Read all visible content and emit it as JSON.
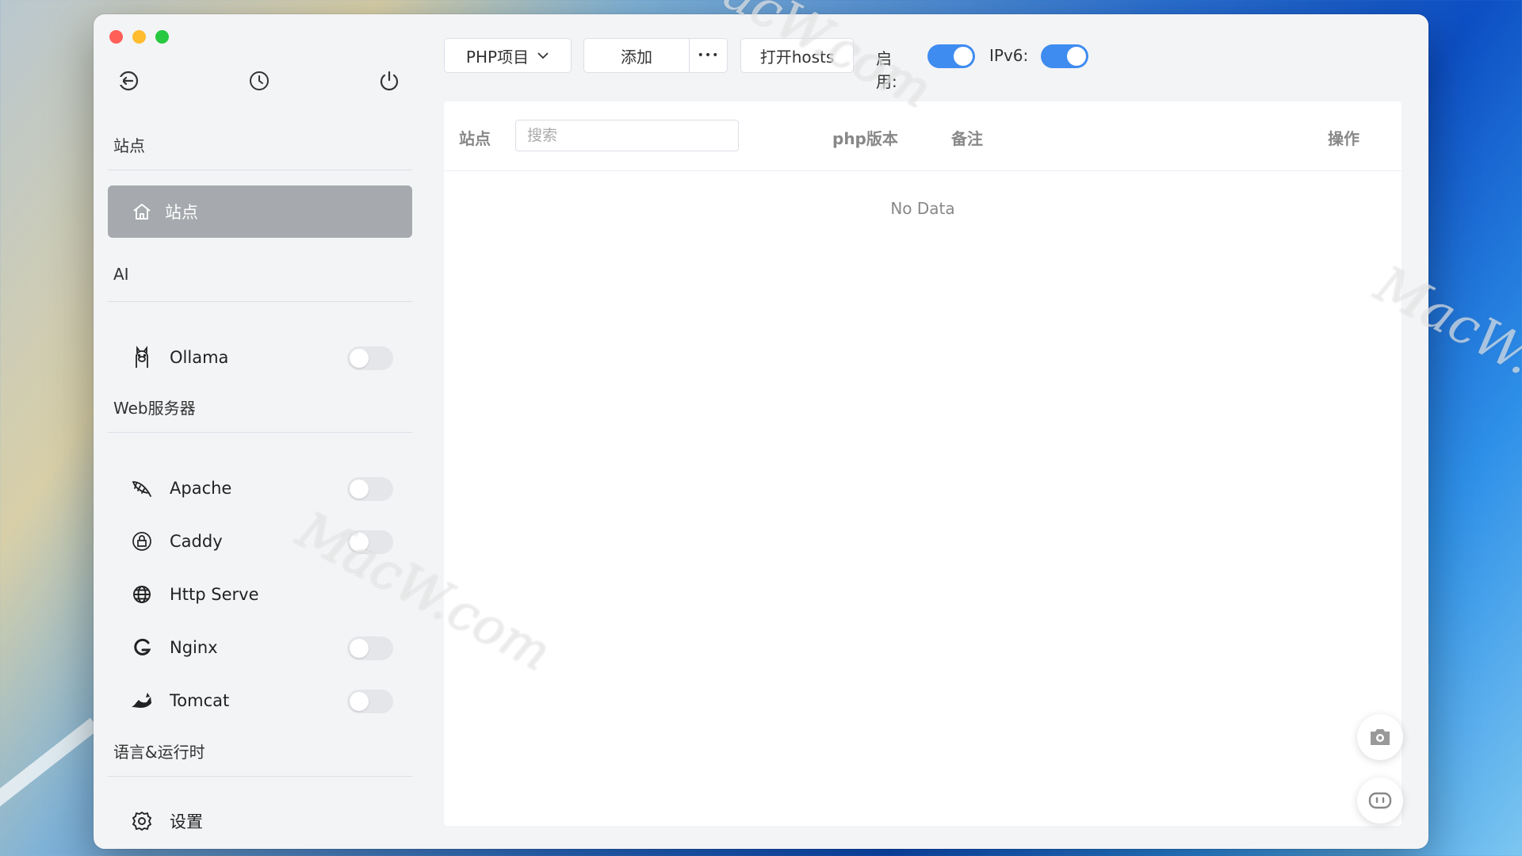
{
  "sidebar": {
    "sections": {
      "sites": "站点",
      "ai": "AI",
      "web": "Web服务器",
      "lang": "语言&运行时"
    },
    "active_item": "站点",
    "ai_items": [
      {
        "label": "Ollama",
        "icon": "llama-icon",
        "enabled": false
      }
    ],
    "web_items": [
      {
        "label": "Apache",
        "icon": "feather-icon",
        "enabled": false
      },
      {
        "label": "Caddy",
        "icon": "caddy-icon",
        "enabled": false
      },
      {
        "label": "Http Serve",
        "icon": "globe-icon"
      },
      {
        "label": "Nginx",
        "icon": "nginx-icon",
        "enabled": false
      },
      {
        "label": "Tomcat",
        "icon": "tomcat-icon",
        "enabled": false
      }
    ],
    "settings_label": "设置"
  },
  "toolbar": {
    "project_select": "PHP项目",
    "add_label": "添加",
    "more_label": "•••",
    "open_hosts_label": "打开hosts",
    "enable_label": "启用:",
    "ipv6_label": "IPv6:",
    "enable_on": true,
    "ipv6_on": true
  },
  "table": {
    "columns": {
      "site": "站点",
      "php": "php版本",
      "note": "备注",
      "action": "操作"
    },
    "search_placeholder": "搜索",
    "empty_text": "No Data"
  },
  "watermark": "MacW.com",
  "colors": {
    "accent": "#3e8cf0",
    "active_nav": "#a6a9ad"
  }
}
